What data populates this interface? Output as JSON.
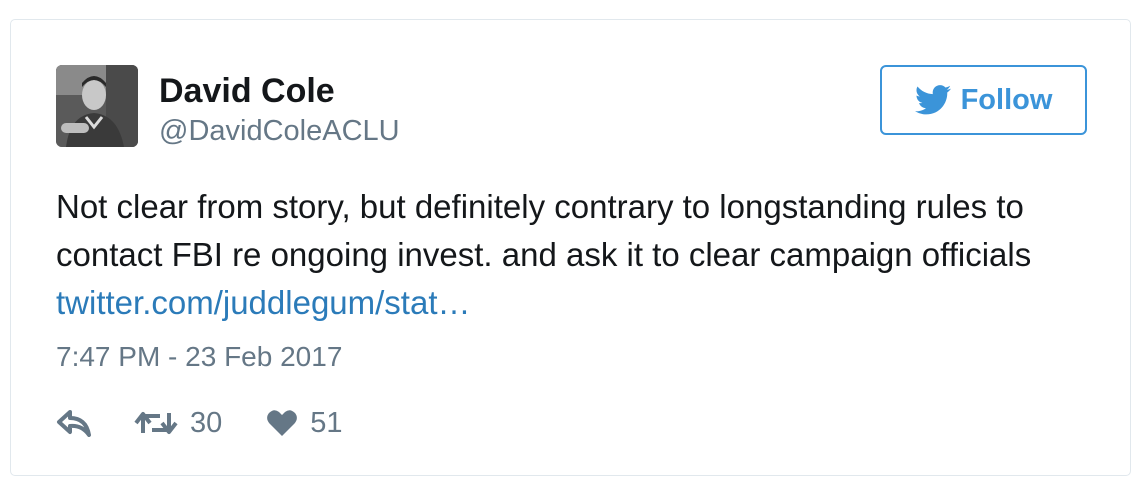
{
  "author": {
    "name": "David Cole",
    "handle": "@DavidColeACLU",
    "avatar_icon": "profile-photo"
  },
  "follow_button": {
    "label": "Follow",
    "icon": "twitter-bird-icon",
    "color": "#3b94d9"
  },
  "tweet": {
    "text": "Not clear from story, but definitely contrary to longstanding rules to contact FBI re ongoing invest. and ask it to clear campaign officials ",
    "link_text": "twitter.com/juddlegum/stat…",
    "link_color": "#2b7bb9",
    "timestamp": "7:47 PM - 23 Feb 2017"
  },
  "actions": {
    "reply_icon": "reply-icon",
    "retweet_icon": "retweet-icon",
    "retweet_count": "30",
    "like_icon": "heart-icon",
    "like_count": "51"
  }
}
